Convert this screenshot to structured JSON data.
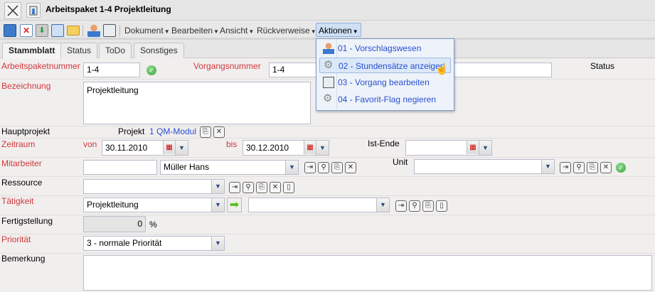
{
  "window": {
    "title": "Arbeitspaket 1-4 Projektleitung"
  },
  "toolbar": {
    "menus": [
      "Dokument",
      "Bearbeiten",
      "Ansicht",
      "Rückverweise",
      "Aktionen"
    ]
  },
  "tabs": [
    "Stammblatt",
    "Status",
    "ToDo",
    "Sonstiges"
  ],
  "actions_menu": [
    "01 - Vorschlagswesen",
    "02 - Stundensätze anzeigen",
    "03 - Vorgang bearbeiten",
    "04 - Favorit-Flag negieren"
  ],
  "form": {
    "arbeitspaketnummer": {
      "label": "Arbeitspaketnummer",
      "value": "1-4"
    },
    "vorgangsnummer": {
      "label": "Vorgangsnummer",
      "value": "1-4"
    },
    "status": {
      "label": "Status"
    },
    "bezeichnung": {
      "label": "Bezeichnung",
      "value": "Projektleitung"
    },
    "hauptprojekt": {
      "label": "Hauptprojekt",
      "prefix": "Projekt",
      "link": "1 QM-Modul"
    },
    "zeitraum": {
      "label": "Zeitraum",
      "von": "von",
      "von_value": "30.11.2010",
      "bis": "bis",
      "bis_value": "30.12.2010"
    },
    "ist_ende": {
      "label": "Ist-Ende",
      "value": ""
    },
    "mitarbeiter": {
      "label": "Mitarbeiter",
      "code": "",
      "value": "Müller Hans"
    },
    "unit": {
      "label": "Unit",
      "value": ""
    },
    "ressource": {
      "label": "Ressource",
      "value": ""
    },
    "taetigkeit": {
      "label": "Tätigkeit",
      "value": "Projektleitung",
      "second": ""
    },
    "fertigstellung": {
      "label": "Fertigstellung",
      "value": "0",
      "unit": "%"
    },
    "prioritaet": {
      "label": "Priorität",
      "value": "3 - normale Priorität"
    },
    "bemerkung": {
      "label": "Bemerkung",
      "value": ""
    }
  }
}
